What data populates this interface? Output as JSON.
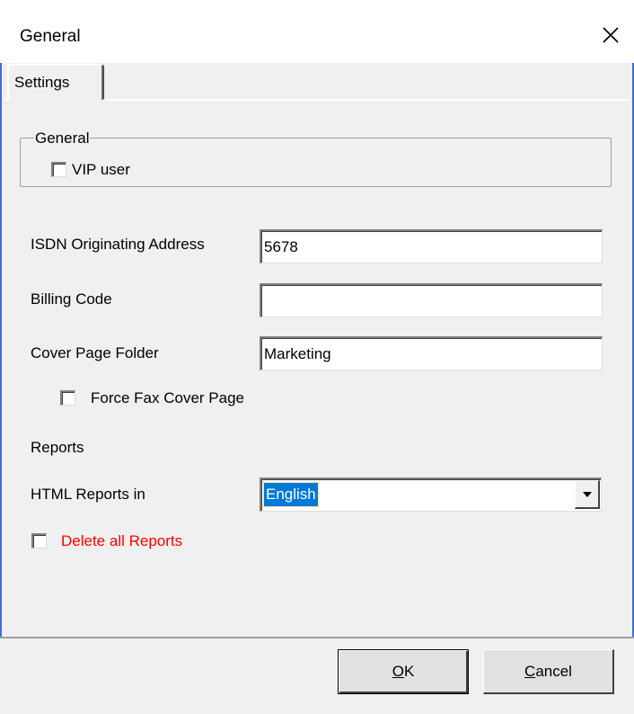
{
  "window": {
    "title": "General",
    "close_glyph": "✕"
  },
  "tabs": [
    {
      "label": "Settings",
      "selected": true
    }
  ],
  "general_group": {
    "legend": "General",
    "vip_user": {
      "label": "VIP user",
      "checked": false
    }
  },
  "fields": {
    "isdn": {
      "label": "ISDN Originating Address",
      "value": "5678"
    },
    "billing": {
      "label": "Billing Code",
      "value": ""
    },
    "cover_folder": {
      "label": "Cover Page Folder",
      "value": "Marketing"
    }
  },
  "force_cover": {
    "label": "Force Fax Cover Page",
    "checked": false
  },
  "reports": {
    "section_label": "Reports",
    "html_label": "HTML Reports in",
    "language": "English",
    "delete_all": {
      "label": "Delete all Reports",
      "checked": false,
      "color": "#ff0000"
    }
  },
  "buttons": {
    "ok_mnemonic": "O",
    "ok_rest": "K",
    "cancel_mnemonic": "C",
    "cancel_rest": "ancel"
  },
  "colors": {
    "frame": "#3a71d6",
    "selection": "#0078d7"
  }
}
